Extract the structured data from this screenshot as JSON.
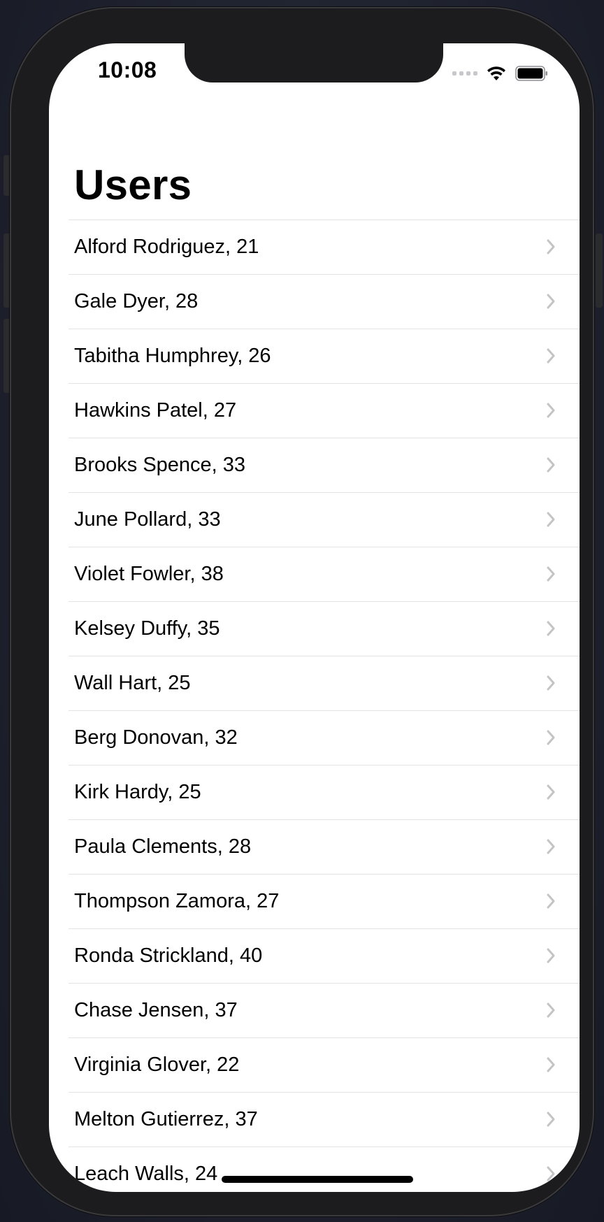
{
  "status_bar": {
    "time": "10:08"
  },
  "header": {
    "title": "Users"
  },
  "users": [
    {
      "label": "Alford Rodriguez, 21"
    },
    {
      "label": "Gale Dyer, 28"
    },
    {
      "label": "Tabitha Humphrey, 26"
    },
    {
      "label": "Hawkins Patel, 27"
    },
    {
      "label": "Brooks Spence, 33"
    },
    {
      "label": "June Pollard, 33"
    },
    {
      "label": "Violet Fowler, 38"
    },
    {
      "label": "Kelsey Duffy, 35"
    },
    {
      "label": "Wall Hart, 25"
    },
    {
      "label": "Berg Donovan, 32"
    },
    {
      "label": "Kirk Hardy, 25"
    },
    {
      "label": "Paula Clements, 28"
    },
    {
      "label": "Thompson Zamora, 27"
    },
    {
      "label": "Ronda Strickland, 40"
    },
    {
      "label": "Chase Jensen, 37"
    },
    {
      "label": "Virginia Glover, 22"
    },
    {
      "label": "Melton Gutierrez, 37"
    },
    {
      "label": "Leach Walls, 24"
    }
  ],
  "icons": {
    "row_accessory": "chevron-right-icon",
    "wifi": "wifi-icon",
    "battery": "battery-icon",
    "signal": "cellular-signal-icon"
  },
  "colors": {
    "separator": "#e3e3e6",
    "chevron": "#c4c4c7",
    "background": "#ffffff"
  }
}
